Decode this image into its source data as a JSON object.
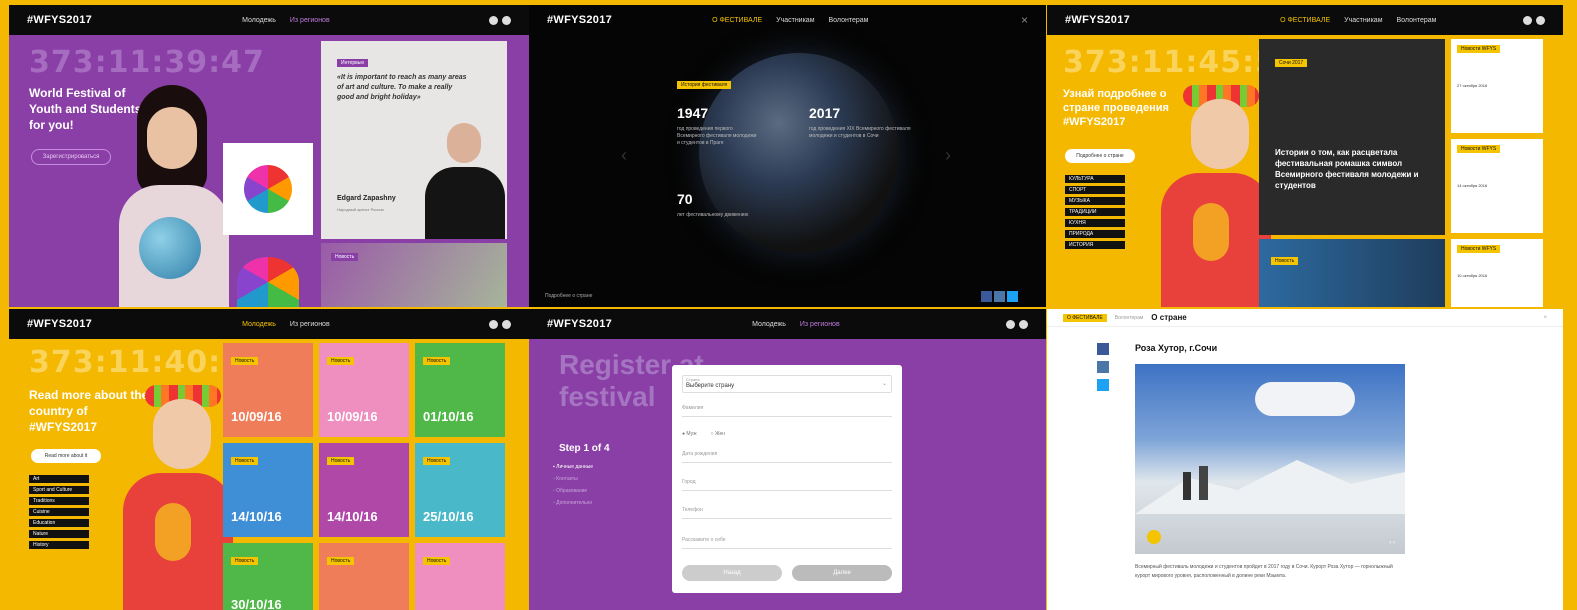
{
  "p1": {
    "logo": "#WFYS2017",
    "nav": [
      "Молодежь",
      "Из регионов"
    ],
    "timer": "373:11:39:47",
    "title": "World Festival of Youth and Students for you!",
    "cta": "Зарегистрироваться",
    "quote_badge": "Интервью",
    "quote": "«It is important to reach as many areas of art and culture. To make a really good and bright holiday»",
    "person_name": "Edgard Zapashny",
    "person_role": "Народный артист России",
    "tile_badge": "Новость"
  },
  "p2": {
    "logo": "#WFYS2017",
    "nav": [
      "О ФЕСТИВАЛЕ",
      "Участникам",
      "Волонтерам"
    ],
    "badge": "История фестиваля",
    "stats": [
      {
        "value": "1947",
        "desc": "год проведения первого Всемирного фестиваля молодежи и студентов в Праге"
      },
      {
        "value": "2017",
        "desc": "год проведения XIX Всемирного фестиваля молодежи и студентов в Сочи"
      },
      {
        "value": "70",
        "desc": "лет фестивальному движению"
      }
    ],
    "footer": "Подробнее о стране",
    "close": "×"
  },
  "p3": {
    "logo": "#WFYS2017",
    "nav": [
      "О ФЕСТИВАЛЕ",
      "Участникам",
      "Волонтерам"
    ],
    "timer": "373:11:45:5",
    "title": "Узнай подробнее о стране проведения #WFYS2017",
    "cta": "Подробнее о стране",
    "tags": [
      "КУЛЬТУРА",
      "СПОРТ",
      "МУЗЫКА",
      "ТРАДИЦИИ",
      "КУХНЯ",
      "ПРИРОДА",
      "ИСТОРИЯ"
    ],
    "feature_badge": "Сочи 2017",
    "feature_title": "Истории о том, как расцветала фестивальная ромашка символ Всемирного фестиваля молодежи и студентов",
    "side_badges": [
      "Новости WFYS",
      "Новости WFYS",
      "Новости WFYS"
    ],
    "side_dates": [
      "27 октября 2016",
      "14 октября 2016",
      "10 октября 2016"
    ],
    "bottom_badge": "Новость"
  },
  "p4": {
    "logo": "#WFYS2017",
    "nav": [
      "Молодежь",
      "Из регионов"
    ],
    "timer": "373:11:40:2",
    "title": "Read more about the country of #WFYS2017",
    "cta": "Read more about it",
    "tags": [
      "Art",
      "Sport and Culture",
      "Traditions",
      "Cuisine",
      "Education",
      "Nature",
      "History"
    ],
    "cards": [
      {
        "badge": "Новость",
        "date": "10/09/16",
        "color": "#f07d5a"
      },
      {
        "badge": "Новость",
        "date": "10/09/16",
        "color": "#ee8fbf"
      },
      {
        "badge": "Новость",
        "date": "01/10/16",
        "color": "#4fb848"
      },
      {
        "badge": "Новость",
        "date": "14/10/16",
        "color": "#3e8fd6"
      },
      {
        "badge": "Новость",
        "date": "14/10/16",
        "color": "#b048a8"
      },
      {
        "badge": "Новость",
        "date": "25/10/16",
        "color": "#49b8c8"
      },
      {
        "badge": "Новость",
        "date": "30/10/16",
        "color": "#4fb848"
      },
      {
        "badge": "Новость",
        "date": "",
        "color": "#f07d5a"
      },
      {
        "badge": "Новость",
        "date": "",
        "color": "#ee8fbf"
      }
    ]
  },
  "p5": {
    "logo": "#WFYS2017",
    "nav": [
      "Молодежь",
      "Из регионов"
    ],
    "title": "Register at festival",
    "step": "Step 1 of 4",
    "steps": [
      "Личные данные",
      "Контакты",
      "Образование",
      "Дополнительно"
    ],
    "select_label": "Страна",
    "select_value": "Выберите страну",
    "fields": [
      "Фамилия",
      "Дата рождения",
      "Город",
      "Телефон",
      "Расскажите о себе"
    ],
    "radio": [
      "Муж",
      "Жен"
    ],
    "btn_back": "Назад",
    "btn_next": "Далее"
  },
  "p6": {
    "breadcrumb": [
      "О ФЕСТИВАЛЕ",
      "Волонтерам"
    ],
    "section": "О стране",
    "heading": "Роза Хутор, г.Сочи",
    "body": "Всемирный фестиваль молодежи и студентов пройдет в 2017 году в Сочи. Курорт Роза Хутор — горнолыжный курорт мирового уровня, расположенный в долине реки Мзымта."
  },
  "colors": {
    "yellow": "#f5b800",
    "purple": "#8a3fa6",
    "black": "#0b0b0b"
  }
}
